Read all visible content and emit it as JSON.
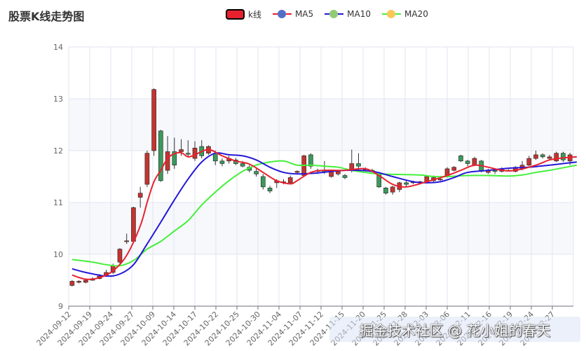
{
  "title": "股票K线走势图",
  "legend": [
    {
      "label": "k线",
      "kind": "candle",
      "color": "#e8212e"
    },
    {
      "label": "MA5",
      "kind": "line",
      "color": "#e8212e",
      "dot": "#5470c6"
    },
    {
      "label": "MA10",
      "kind": "line",
      "color": "#2418d8",
      "dot": "#91cc75"
    },
    {
      "label": "MA20",
      "kind": "line",
      "color": "#45f03a",
      "dot": "#fac858"
    }
  ],
  "watermark": "掘金技术社区 @ 花小姐的春天",
  "colors": {
    "up": "#c23531",
    "down": "#3a9a5c",
    "ma5": "#e8212e",
    "ma10": "#2418d8",
    "ma20": "#45f03a",
    "grid": "#e0e6f1",
    "band": "#f6f8fc"
  },
  "chart_data": {
    "type": "candlestick",
    "title": "股票K线走势图",
    "ylim": [
      9,
      14
    ],
    "yticks": [
      9,
      10,
      11,
      12,
      13,
      14
    ],
    "grid": true,
    "legend_position": "top-center",
    "xtick_labels": [
      "2024-09-12",
      "2024-09-19",
      "2024-09-24",
      "2024-09-27",
      "2024-10-09",
      "2024-10-14",
      "2024-10-17",
      "2024-10-22",
      "2024-10-25",
      "2024-10-30",
      "2024-11-04",
      "2024-11-07",
      "2024-11-12",
      "2024-11-15",
      "2024-11-20",
      "2024-11-25",
      "2024-11-28",
      "2024-12-03",
      "2024-12-06",
      "2024-12-11",
      "2024-12-16",
      "2024-12-19",
      "2024-12-24",
      "2024-12-27"
    ],
    "candles": [
      [
        9.4,
        9.48,
        9.38,
        9.5
      ],
      [
        9.46,
        9.48,
        9.44,
        9.5
      ],
      [
        9.46,
        9.5,
        9.44,
        9.52
      ],
      [
        9.5,
        9.53,
        9.49,
        9.56
      ],
      [
        9.53,
        9.58,
        9.52,
        9.62
      ],
      [
        9.6,
        9.65,
        9.58,
        9.7
      ],
      [
        9.65,
        9.78,
        9.62,
        9.82
      ],
      [
        9.85,
        10.1,
        9.82,
        10.12
      ],
      [
        10.25,
        10.26,
        10.2,
        10.4
      ],
      [
        10.25,
        10.9,
        10.22,
        10.92
      ],
      [
        11.1,
        11.18,
        10.9,
        11.3
      ],
      [
        11.35,
        11.95,
        11.3,
        12.0
      ],
      [
        12.0,
        13.18,
        11.9,
        13.2
      ],
      [
        12.38,
        11.42,
        11.4,
        12.4
      ],
      [
        11.62,
        11.98,
        11.55,
        12.28
      ],
      [
        11.98,
        11.72,
        11.65,
        12.25
      ],
      [
        11.98,
        12.02,
        11.9,
        12.22
      ],
      [
        11.95,
        11.93,
        11.88,
        12.2
      ],
      [
        11.85,
        12.05,
        11.8,
        12.18
      ],
      [
        12.08,
        11.9,
        11.85,
        12.2
      ],
      [
        11.95,
        12.08,
        11.92,
        12.1
      ],
      [
        11.95,
        11.8,
        11.72,
        12.0
      ],
      [
        11.8,
        11.75,
        11.7,
        11.85
      ],
      [
        11.8,
        11.85,
        11.75,
        11.9
      ],
      [
        11.82,
        11.75,
        11.72,
        11.86
      ],
      [
        11.75,
        11.7,
        11.68,
        11.8
      ],
      [
        11.68,
        11.62,
        11.58,
        11.72
      ],
      [
        11.6,
        11.55,
        11.5,
        11.65
      ],
      [
        11.5,
        11.3,
        11.25,
        11.55
      ],
      [
        11.28,
        11.22,
        11.18,
        11.32
      ],
      [
        11.38,
        11.42,
        11.28,
        11.45
      ],
      [
        11.4,
        11.4,
        11.35,
        11.45
      ],
      [
        11.38,
        11.48,
        11.35,
        11.52
      ],
      [
        11.58,
        11.6,
        11.55,
        11.62
      ],
      [
        11.52,
        11.9,
        11.5,
        11.92
      ],
      [
        11.92,
        11.7,
        11.65,
        11.95
      ],
      [
        11.6,
        11.62,
        11.55,
        11.65
      ],
      [
        11.62,
        11.58,
        11.55,
        11.8
      ],
      [
        11.5,
        11.6,
        11.48,
        11.62
      ],
      [
        11.55,
        11.6,
        11.52,
        11.62
      ],
      [
        11.52,
        11.48,
        11.45,
        11.55
      ],
      [
        11.62,
        11.75,
        11.58,
        12.02
      ],
      [
        11.75,
        11.7,
        11.6,
        11.95
      ],
      [
        11.65,
        11.65,
        11.6,
        11.68
      ],
      [
        11.62,
        11.6,
        11.58,
        11.65
      ],
      [
        11.55,
        11.3,
        11.28,
        11.58
      ],
      [
        11.28,
        11.18,
        11.15,
        11.3
      ],
      [
        11.2,
        11.3,
        11.15,
        11.32
      ],
      [
        11.25,
        11.38,
        11.2,
        11.4
      ],
      [
        11.38,
        11.35,
        11.3,
        11.42
      ],
      [
        11.38,
        11.4,
        11.35,
        11.42
      ],
      [
        11.4,
        11.38,
        11.35,
        11.42
      ],
      [
        11.4,
        11.5,
        11.38,
        11.52
      ],
      [
        11.42,
        11.48,
        11.4,
        11.52
      ],
      [
        11.45,
        11.45,
        11.42,
        11.48
      ],
      [
        11.5,
        11.65,
        11.48,
        11.68
      ],
      [
        11.62,
        11.68,
        11.6,
        11.7
      ],
      [
        11.9,
        11.8,
        11.78,
        11.92
      ],
      [
        11.8,
        11.75,
        11.7,
        11.82
      ],
      [
        11.72,
        11.85,
        11.7,
        11.88
      ],
      [
        11.8,
        11.6,
        11.58,
        11.82
      ],
      [
        11.58,
        11.62,
        11.55,
        11.65
      ],
      [
        11.62,
        11.6,
        11.55,
        11.65
      ],
      [
        11.6,
        11.65,
        11.58,
        11.68
      ],
      [
        11.62,
        11.62,
        11.6,
        11.64
      ],
      [
        11.6,
        11.68,
        11.58,
        11.7
      ],
      [
        11.65,
        11.72,
        11.62,
        11.8
      ],
      [
        11.72,
        11.85,
        11.7,
        11.9
      ],
      [
        11.85,
        11.92,
        11.82,
        12.0
      ],
      [
        11.92,
        11.88,
        11.85,
        11.95
      ],
      [
        11.85,
        11.88,
        11.82,
        11.92
      ],
      [
        11.8,
        11.95,
        11.78,
        11.98
      ],
      [
        11.95,
        11.82,
        11.78,
        11.98
      ],
      [
        11.8,
        11.92,
        11.72,
        11.96
      ]
    ],
    "ma5_points": [
      [
        0,
        9.6
      ],
      [
        2,
        9.52
      ],
      [
        4,
        9.55
      ],
      [
        6,
        9.68
      ],
      [
        8,
        9.98
      ],
      [
        10,
        10.55
      ],
      [
        11,
        11.0
      ],
      [
        12,
        11.4
      ],
      [
        13,
        11.62
      ],
      [
        14,
        11.85
      ],
      [
        15,
        11.94
      ],
      [
        16,
        11.96
      ],
      [
        17,
        11.88
      ],
      [
        18,
        11.92
      ],
      [
        20,
        12.02
      ],
      [
        22,
        11.9
      ],
      [
        24,
        11.8
      ],
      [
        26,
        11.74
      ],
      [
        28,
        11.58
      ],
      [
        30,
        11.42
      ],
      [
        32,
        11.36
      ],
      [
        33,
        11.42
      ],
      [
        35,
        11.58
      ],
      [
        37,
        11.62
      ],
      [
        40,
        11.62
      ],
      [
        43,
        11.65
      ],
      [
        45,
        11.52
      ],
      [
        47,
        11.35
      ],
      [
        49,
        11.3
      ],
      [
        52,
        11.4
      ],
      [
        55,
        11.52
      ],
      [
        57,
        11.62
      ],
      [
        59,
        11.72
      ],
      [
        61,
        11.68
      ],
      [
        63,
        11.62
      ],
      [
        65,
        11.62
      ],
      [
        68,
        11.72
      ],
      [
        70,
        11.82
      ],
      [
        72,
        11.86
      ],
      [
        74,
        11.88
      ]
    ],
    "ma10_points": [
      [
        0,
        9.72
      ],
      [
        2,
        9.65
      ],
      [
        5,
        9.58
      ],
      [
        7,
        9.62
      ],
      [
        9,
        9.8
      ],
      [
        11,
        10.2
      ],
      [
        13,
        10.62
      ],
      [
        15,
        11.05
      ],
      [
        17,
        11.45
      ],
      [
        19,
        11.78
      ],
      [
        21,
        11.95
      ],
      [
        23,
        11.92
      ],
      [
        25,
        11.9
      ],
      [
        27,
        11.82
      ],
      [
        29,
        11.68
      ],
      [
        31,
        11.58
      ],
      [
        33,
        11.55
      ],
      [
        36,
        11.57
      ],
      [
        40,
        11.62
      ],
      [
        44,
        11.6
      ],
      [
        47,
        11.5
      ],
      [
        50,
        11.4
      ],
      [
        52,
        11.38
      ],
      [
        54,
        11.4
      ],
      [
        56,
        11.48
      ],
      [
        58,
        11.58
      ],
      [
        61,
        11.62
      ],
      [
        64,
        11.66
      ],
      [
        67,
        11.68
      ],
      [
        70,
        11.72
      ],
      [
        72,
        11.75
      ],
      [
        74,
        11.78
      ]
    ],
    "ma20_points": [
      [
        0,
        9.9
      ],
      [
        3,
        9.85
      ],
      [
        5,
        9.8
      ],
      [
        7,
        9.78
      ],
      [
        9,
        9.88
      ],
      [
        11,
        10.1
      ],
      [
        13,
        10.25
      ],
      [
        15,
        10.45
      ],
      [
        17,
        10.65
      ],
      [
        19,
        10.95
      ],
      [
        21,
        11.2
      ],
      [
        23,
        11.42
      ],
      [
        25,
        11.6
      ],
      [
        27,
        11.72
      ],
      [
        29,
        11.78
      ],
      [
        31,
        11.8
      ],
      [
        33,
        11.72
      ],
      [
        35,
        11.72
      ],
      [
        37,
        11.7
      ],
      [
        39,
        11.68
      ],
      [
        41,
        11.62
      ],
      [
        43,
        11.58
      ],
      [
        45,
        11.55
      ],
      [
        48,
        11.54
      ],
      [
        51,
        11.53
      ],
      [
        53,
        11.5
      ],
      [
        55,
        11.5
      ],
      [
        58,
        11.52
      ],
      [
        61,
        11.52
      ],
      [
        64,
        11.51
      ],
      [
        66,
        11.53
      ],
      [
        68,
        11.58
      ],
      [
        70,
        11.62
      ],
      [
        72,
        11.67
      ],
      [
        74,
        11.72
      ]
    ]
  }
}
